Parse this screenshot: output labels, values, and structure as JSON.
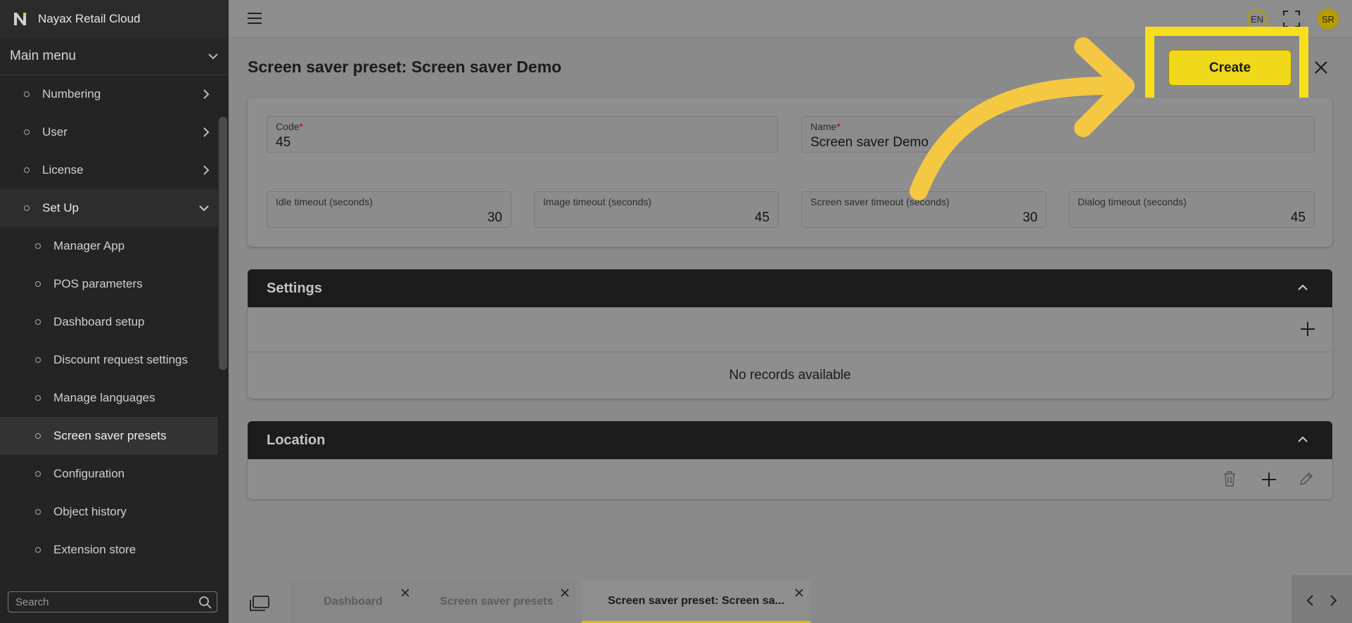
{
  "app": {
    "title": "Nayax Retail Cloud"
  },
  "sidebar": {
    "main_menu_label": "Main menu",
    "items": [
      {
        "label": "Numbering"
      },
      {
        "label": "User"
      },
      {
        "label": "License"
      },
      {
        "label": "Set Up"
      }
    ],
    "sub_items": [
      {
        "label": "Manager App"
      },
      {
        "label": "POS parameters"
      },
      {
        "label": "Dashboard setup"
      },
      {
        "label": "Discount request settings"
      },
      {
        "label": "Manage languages"
      },
      {
        "label": "Screen saver presets"
      },
      {
        "label": "Configuration"
      },
      {
        "label": "Object history"
      },
      {
        "label": "Extension store"
      }
    ],
    "search_placeholder": "Search"
  },
  "topbar": {
    "language": "EN",
    "user_initials": "SR"
  },
  "page": {
    "title": "Screen saver preset: Screen saver Demo",
    "create_label": "Create"
  },
  "form": {
    "code": {
      "label": "Code",
      "required": "*",
      "value": "45"
    },
    "name": {
      "label": "Name",
      "required": "*",
      "value": "Screen saver Demo"
    },
    "idle_timeout": {
      "label": "Idle timeout (seconds)",
      "value": "30"
    },
    "image_timeout": {
      "label": "Image timeout (seconds)",
      "value": "45"
    },
    "screen_saver_timeout": {
      "label": "Screen saver timeout (seconds)",
      "value": "30"
    },
    "dialog_timeout": {
      "label": "Dialog timeout (seconds)",
      "value": "45"
    }
  },
  "settings": {
    "title": "Settings",
    "empty_text": "No records available"
  },
  "location": {
    "title": "Location"
  },
  "tabs": [
    {
      "label": "Dashboard"
    },
    {
      "label": "Screen saver presets"
    },
    {
      "label": "Screen saver preset: Screen sa..."
    }
  ],
  "colors": {
    "accent": "#f0d81a",
    "highlight_frame": "#f7df1e",
    "arrow": "#f5c842",
    "section_header": "#1c1c1c"
  },
  "icons": [
    "hamburger-icon",
    "fullscreen-icon",
    "close-icon",
    "plus-icon",
    "trash-icon",
    "pencil-icon",
    "chevron-up-icon",
    "chevron-right-icon",
    "chevron-down-icon",
    "search-icon",
    "tabs-icon",
    "curved-arrow-icon"
  ]
}
